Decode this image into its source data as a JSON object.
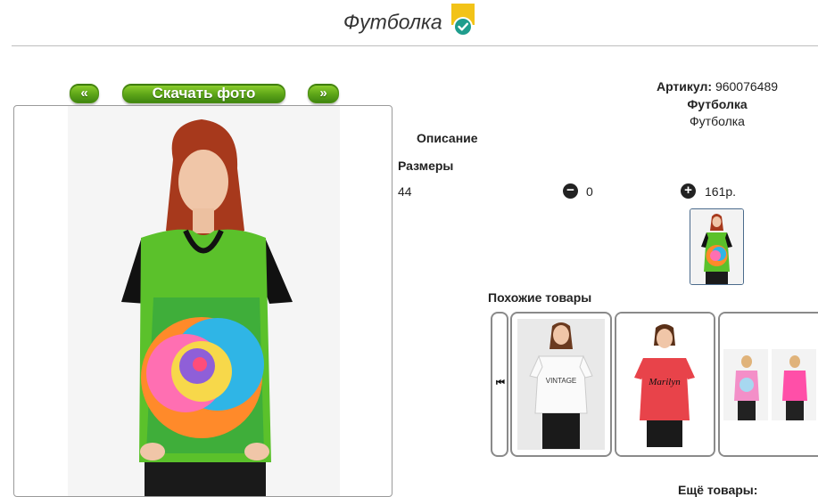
{
  "page": {
    "title": "Футболка"
  },
  "photo_nav": {
    "prev_label": "«",
    "download_label": "Скачать фото",
    "next_label": "»"
  },
  "product": {
    "article_label": "Артикул:",
    "article_value": "960076489",
    "name_bold": "Футболка",
    "name": "Футболка",
    "description_heading": "Описание",
    "sizes_heading": "Размеры",
    "size": "44",
    "quantity": "0",
    "price": "161р."
  },
  "controls": {
    "minus_glyph": "−",
    "plus_glyph": "+"
  },
  "similar": {
    "heading": "Похожие товары",
    "left_arrow": "⏮",
    "items": [
      {
        "print": "VINTAGE"
      },
      {
        "print": "Marilyn"
      },
      {
        "print": ""
      }
    ]
  },
  "more": {
    "heading": "Ещё товары:"
  },
  "colors": {
    "accent_green": "#5da518",
    "badge_yellow": "#f2c318",
    "badge_teal": "#1f9d8d"
  },
  "icons": [
    "verified-badge-icon",
    "minus-icon",
    "plus-icon",
    "carousel-first-icon"
  ]
}
